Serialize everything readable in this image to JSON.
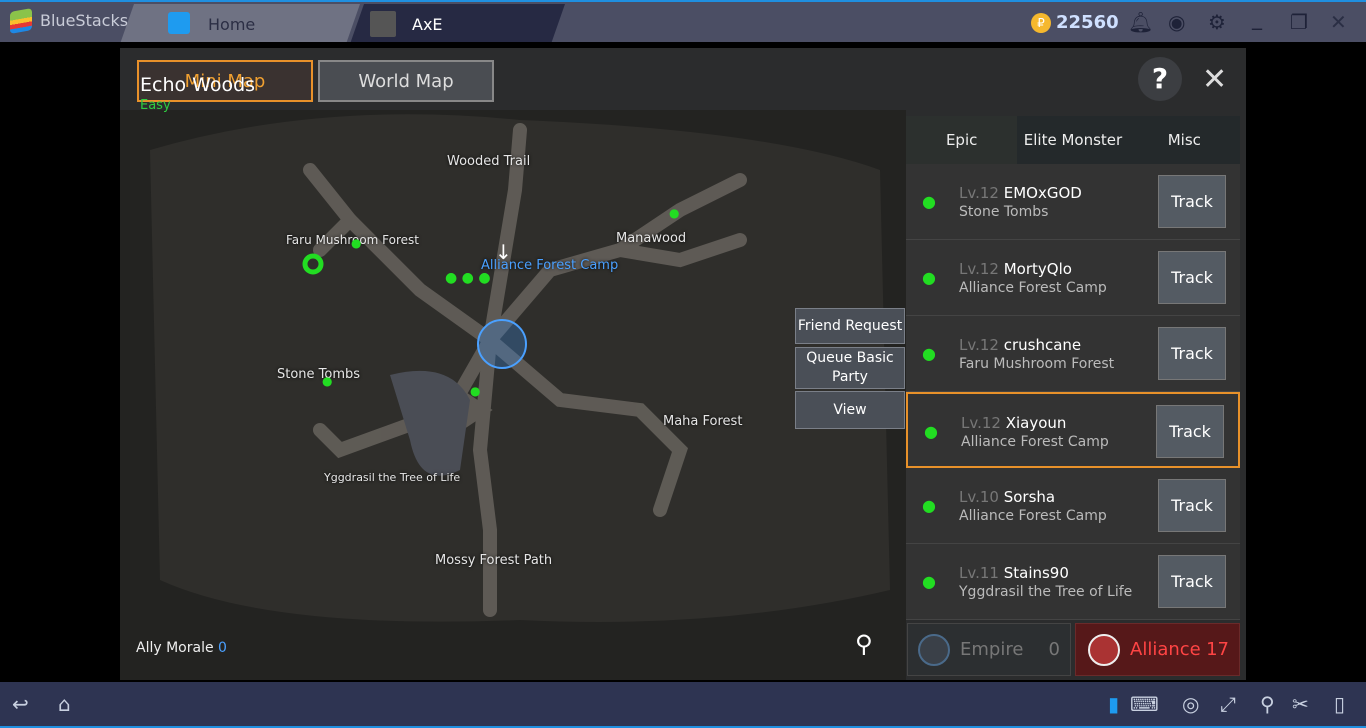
{
  "app": {
    "name": "BlueStacks",
    "tabs": [
      {
        "label": "Home"
      },
      {
        "label": "AxE"
      }
    ],
    "coins": "22560"
  },
  "header": {
    "mini_map": "Mini Map",
    "world_map": "World Map",
    "help": "?",
    "close": "✕"
  },
  "map": {
    "zone": "Echo Woods",
    "difficulty": "Easy",
    "ally_morale_label": "Ally Morale",
    "ally_morale": "0",
    "labels": [
      "Wooded Trail",
      "Faru Mushroom Forest",
      "Manawood",
      "Alliance Forest Camp",
      "Stone Tombs",
      "Maha Forest",
      "Yggdrasil the Tree of Life",
      "Mossy Forest Path"
    ]
  },
  "context_menu": [
    "Friend Request",
    "Queue Basic Party",
    "View"
  ],
  "list": {
    "tabs": [
      "Epic",
      "Elite Monster",
      "Misc"
    ],
    "track_label": "Track",
    "rows": [
      {
        "level": "Lv.12",
        "name": "EMOxGOD",
        "location": "Stone Tombs"
      },
      {
        "level": "Lv.12",
        "name": "MortyQlo",
        "location": "Alliance Forest Camp"
      },
      {
        "level": "Lv.12",
        "name": "crushcane",
        "location": "Faru Mushroom Forest"
      },
      {
        "level": "Lv.12",
        "name": "Xiayoun",
        "location": "Alliance Forest Camp"
      },
      {
        "level": "Lv.10",
        "name": "Sorsha",
        "location": "Alliance Forest Camp"
      },
      {
        "level": "Lv.11",
        "name": "Stains90",
        "location": "Yggdrasil the Tree of Life"
      }
    ]
  },
  "factions": {
    "empire": {
      "label": "Empire",
      "count": "0"
    },
    "alliance": {
      "label": "Alliance",
      "count": "17"
    }
  },
  "colors": {
    "accent_orange": "#e8912a",
    "ally_green": "#22dd22",
    "alliance_red": "#6a1a1c"
  }
}
